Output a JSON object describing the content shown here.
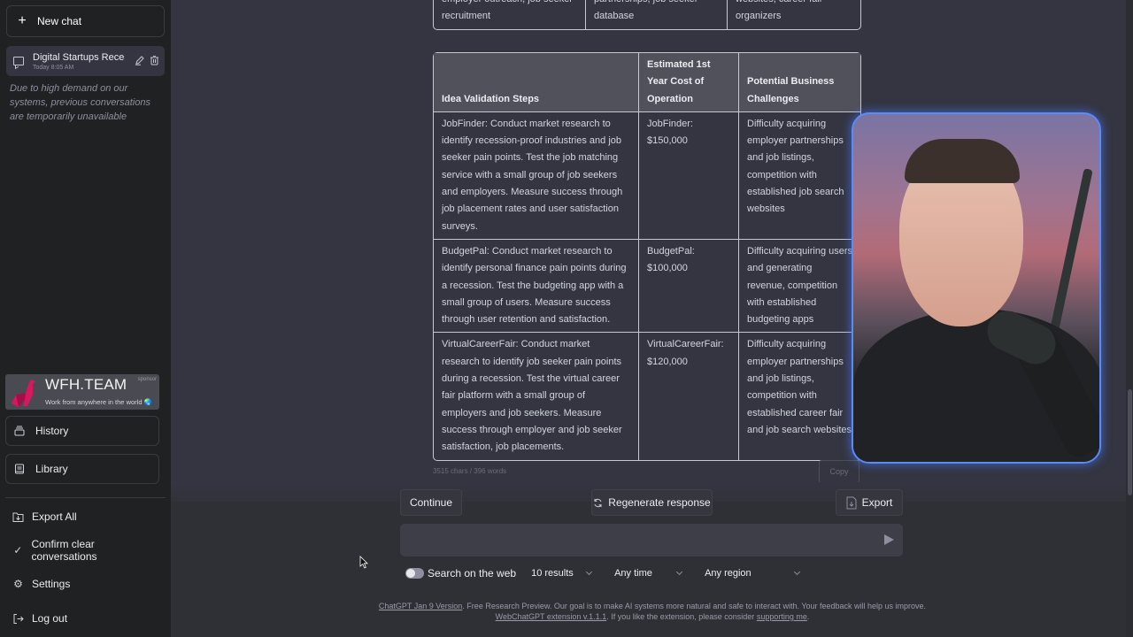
{
  "sidebar": {
    "new_chat": "New chat",
    "conversation": {
      "title": "Digital Startups Recession",
      "time": "Today 8:05 AM"
    },
    "notice": "Due to high demand on our systems, previous conversations are temporarily unavailable",
    "sponsor": {
      "brand": "WFH.TEAM",
      "tagline": "Work from anywhere in the world 🌏",
      "label": "sponsor"
    },
    "history": "History",
    "library": "Library",
    "export_all": "Export All",
    "confirm_clear": "Confirm clear conversations",
    "settings": "Settings",
    "log_out": "Log out"
  },
  "table_prev": {
    "row": [
      "employer outreach, job seeker recruitment",
      "partnerships, job seeker database",
      "websites, career fair organizers"
    ]
  },
  "table": {
    "headers": [
      "Idea Validation Steps",
      "Estimated 1st Year Cost of Operation",
      "Potential Business Challenges"
    ],
    "rows": [
      {
        "steps": "JobFinder: Conduct market research to identify recession-proof industries and job seeker pain points. Test the job matching service with a small group of job seekers and employers. Measure success through job placement rates and user satisfaction surveys.",
        "cost": "JobFinder: $150,000",
        "challenges": "Difficulty acquiring employer partnerships and job listings, competition with established job search websites"
      },
      {
        "steps": "BudgetPal: Conduct market research to identify personal finance pain points during a recession. Test the budgeting app with a small group of users. Measure success through user retention and satisfaction.",
        "cost": "BudgetPal: $100,000",
        "challenges": "Difficulty acquiring users and generating revenue, competition with established budgeting apps"
      },
      {
        "steps": "VirtualCareerFair: Conduct market research to identify job seeker pain points during a recession. Test the virtual career fair platform with a small group of employers and job seekers. Measure success through employer and job seeker satisfaction, job placements.",
        "cost": "VirtualCareerFair: $120,000",
        "challenges": "Difficulty acquiring employer partnerships and job listings, competition with established career fair and job search websites"
      }
    ]
  },
  "response_meta": {
    "stats": "3515 chars / 396 words",
    "copy": "Copy"
  },
  "controls": {
    "continue": "Continue",
    "regenerate": "Regenerate response",
    "export": "Export",
    "input_value": "",
    "input_placeholder": ""
  },
  "web_search": {
    "toggle_label": "Search on the web",
    "enabled": false,
    "results": "10 results",
    "time": "Any time",
    "region": "Any region"
  },
  "footer": {
    "version_link": "ChatGPT Jan 9 Version",
    "line1": ". Free Research Preview. Our goal is to make AI systems more natural and safe to interact with. Your feedback will help us improve.",
    "extension_link": "WebChatGPT extension v.1.1.1",
    "line2": ". If you like the extension, please consider ",
    "support_link": "supporting me",
    "line2_end": "."
  },
  "colors": {
    "sidebar_bg": "#202123",
    "main_bg": "#343541",
    "sponsor_accent": "#d6195e",
    "webcam_border": "#5b8bf5"
  }
}
